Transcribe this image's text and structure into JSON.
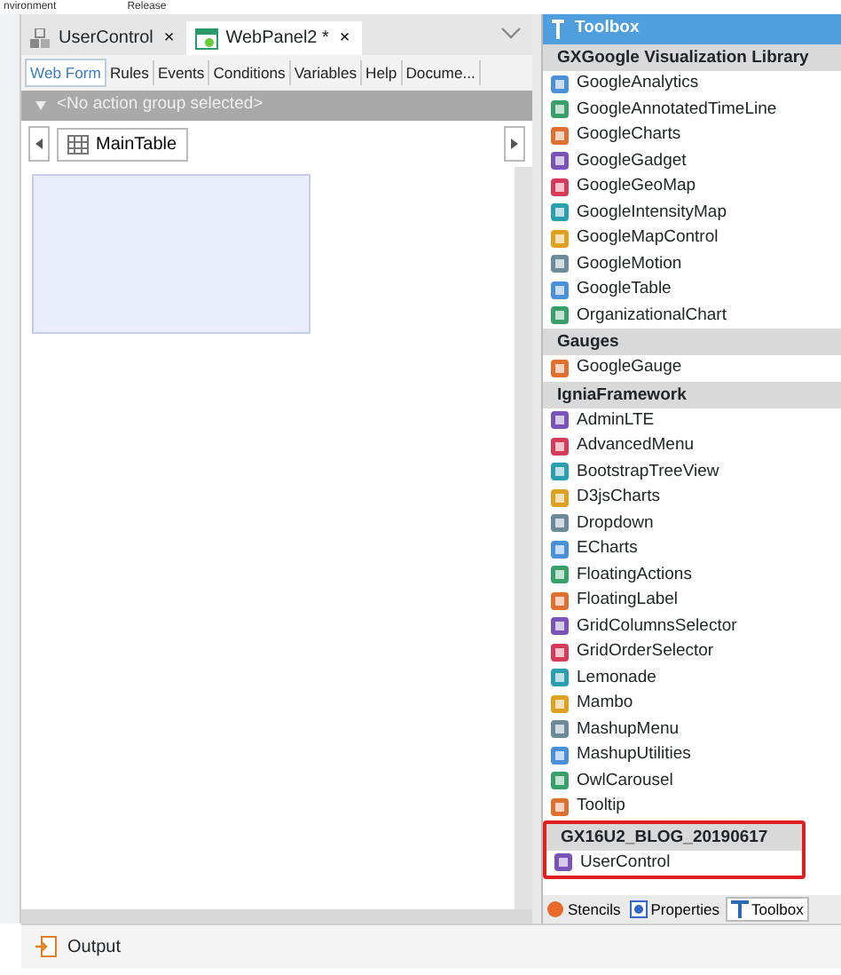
{
  "top_strip": [
    "nvironment",
    "Release"
  ],
  "editor": {
    "tabs": [
      {
        "label": "UserControl",
        "selected": false,
        "close": "×"
      },
      {
        "label": "WebPanel2 *",
        "selected": true,
        "close": "×"
      }
    ],
    "sub_tabs": [
      {
        "label": "Web Form",
        "selected": true
      },
      {
        "label": "Rules",
        "selected": false
      },
      {
        "label": "Events",
        "selected": false
      },
      {
        "label": "Conditions",
        "selected": false
      },
      {
        "label": "Variables",
        "selected": false
      },
      {
        "label": "Help",
        "selected": false
      },
      {
        "label": "Docume...",
        "selected": false
      }
    ],
    "action_group": "<No action group selected>",
    "breadcrumb": "MainTable"
  },
  "toolbox": {
    "title": "Toolbox",
    "groups": [
      {
        "name": "GXGoogle Visualization Library",
        "highlighted": false,
        "items": [
          "GoogleAnalytics",
          "GoogleAnnotatedTimeLine",
          "GoogleCharts",
          "GoogleGadget",
          "GoogleGeoMap",
          "GoogleIntensityMap",
          "GoogleMapControl",
          "GoogleMotion",
          "GoogleTable",
          "OrganizationalChart"
        ]
      },
      {
        "name": "Gauges",
        "highlighted": false,
        "items": [
          "GoogleGauge"
        ]
      },
      {
        "name": "IgniaFramework",
        "highlighted": false,
        "items": [
          "AdminLTE",
          "AdvancedMenu",
          "BootstrapTreeView",
          "D3jsCharts",
          "Dropdown",
          "ECharts",
          "FloatingActions",
          "FloatingLabel",
          "GridColumnsSelector",
          "GridOrderSelector",
          "Lemonade",
          "Mambo",
          "MashupMenu",
          "MashupUtilities",
          "OwlCarousel",
          "Tooltip"
        ]
      },
      {
        "name": "GX16U2_BLOG_20190617",
        "highlighted": true,
        "items": [
          "UserControl"
        ]
      }
    ],
    "tabs": [
      {
        "label": "Stencils",
        "selected": false
      },
      {
        "label": "Properties",
        "selected": false
      },
      {
        "label": "Toolbox",
        "selected": true
      }
    ]
  },
  "output": {
    "label": "Output"
  }
}
